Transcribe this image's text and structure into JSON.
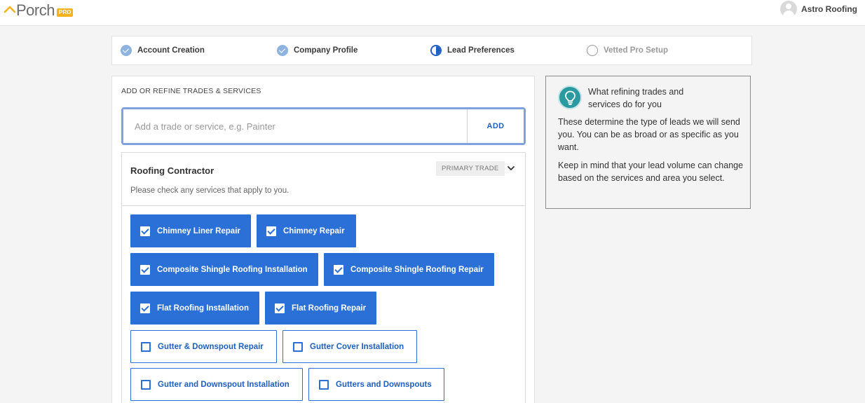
{
  "header": {
    "logo_text": "Porch",
    "logo_badge": "PRO",
    "user_name": "Astro Roofing",
    "accent_color": "#f5b41e"
  },
  "stepper": {
    "steps": [
      {
        "label": "Account Creation",
        "state": "done"
      },
      {
        "label": "Company Profile",
        "state": "done"
      },
      {
        "label": "Lead Preferences",
        "state": "in-progress"
      },
      {
        "label": "Vetted Pro Setup",
        "state": "todo"
      }
    ]
  },
  "main": {
    "section_label": "ADD OR REFINE TRADES & SERVICES",
    "add_input_placeholder": "Add a trade or service, e.g. Painter",
    "add_button": "ADD",
    "trade": {
      "title": "Roofing Contractor",
      "badge": "PRIMARY TRADE",
      "subtitle": "Please check any services that apply to you.",
      "services": [
        {
          "label": "Chimney Liner Repair",
          "checked": true
        },
        {
          "label": "Chimney Repair",
          "checked": true
        },
        {
          "label": "Composite Shingle Roofing Installation",
          "checked": true
        },
        {
          "label": "Composite Shingle Roofing Repair",
          "checked": true
        },
        {
          "label": "Flat Roofing Installation",
          "checked": true
        },
        {
          "label": "Flat Roofing Repair",
          "checked": true
        },
        {
          "label": "Gutter & Downspout Repair",
          "checked": false
        },
        {
          "label": "Gutter Cover Installation",
          "checked": false
        },
        {
          "label": "Gutter and Downspout Installation",
          "checked": false
        },
        {
          "label": "Gutters and Downspouts",
          "checked": false
        }
      ]
    }
  },
  "info": {
    "title": "What refining trades and services do for you",
    "paragraph1": "These determine the type of leads we will send you. You can be as broad or as specific as you want.",
    "paragraph2": "Keep in mind that your lead volume can change based on the services and area you select.",
    "icon": "lightbulb-icon"
  },
  "colors": {
    "primary_blue": "#2a70d6",
    "teal": "#2b9aa0"
  }
}
